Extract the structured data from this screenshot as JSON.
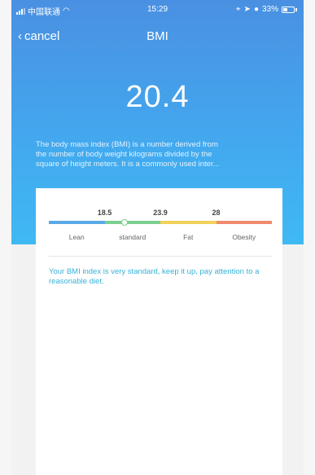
{
  "status_bar": {
    "carrier": "中国联通",
    "time": "15:29",
    "battery": "33%"
  },
  "nav": {
    "back_label": "cancel",
    "title": "BMI"
  },
  "bmi": {
    "value": "20.4"
  },
  "description_lines": [
    "The body mass index (BMI) is a number derived from",
    "the number of body weight kilograms divided by the",
    "square of height meters. It is a commonly used inter..."
  ],
  "scale": {
    "thresholds": [
      "18.5",
      "23.9",
      "28"
    ],
    "categories": [
      {
        "label": "Lean",
        "color": "#5aa9e6"
      },
      {
        "label": "standard",
        "color": "#7ccf8e"
      },
      {
        "label": "Fat",
        "color": "#f2d15a"
      },
      {
        "label": "Obesity",
        "color": "#ef8a6e"
      }
    ],
    "marker_value": 20.4,
    "scale_min": 15.7,
    "scale_max": 32.0
  },
  "advice": "Your BMI index is very standard, keep it up, pay attention to a reasonable diet.",
  "colors": {
    "accent": "#36b1d6",
    "hero_top": "#4a90e2",
    "hero_bottom": "#3fb9f3"
  }
}
